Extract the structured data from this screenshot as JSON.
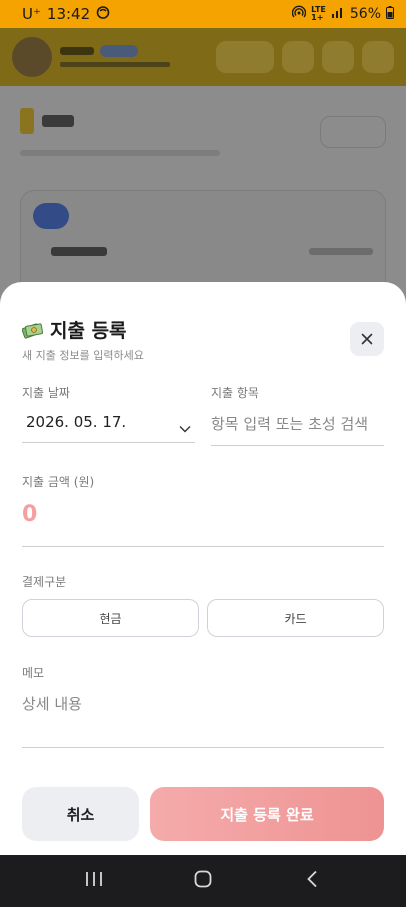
{
  "status_bar": {
    "carrier": "U⁺",
    "time": "13:42",
    "network_top": "LTE",
    "network_bottom": "1+",
    "battery": "56%"
  },
  "modal": {
    "title": "지출 등록",
    "subtitle": "새 지출 정보를 입력하세요",
    "date_label": "지출 날짜",
    "date_value": "2026. 05. 17.",
    "item_label": "지출 항목",
    "item_placeholder": "항목 입력 또는 초성 검색",
    "amount_label": "지출 금액 (원)",
    "amount_value": "0",
    "payment_label": "결제구분",
    "payment_options": [
      "현금",
      "카드"
    ],
    "memo_label": "메모",
    "memo_placeholder": "상세 내용",
    "cancel_label": "취소",
    "submit_label": "지출 등록 완료"
  },
  "colors": {
    "status_bar": "#f5a300",
    "submit_gradient_start": "#f5abab",
    "submit_gradient_end": "#ee9393",
    "amount_color": "#f4a0a0",
    "navbar": "#1c1c1e"
  },
  "icons": {
    "close": "close-icon",
    "title_icon": "money-icon",
    "date_dropdown": "chevron-down-icon",
    "nav_recents": "recents-icon",
    "nav_home": "home-icon",
    "nav_back": "back-icon"
  }
}
